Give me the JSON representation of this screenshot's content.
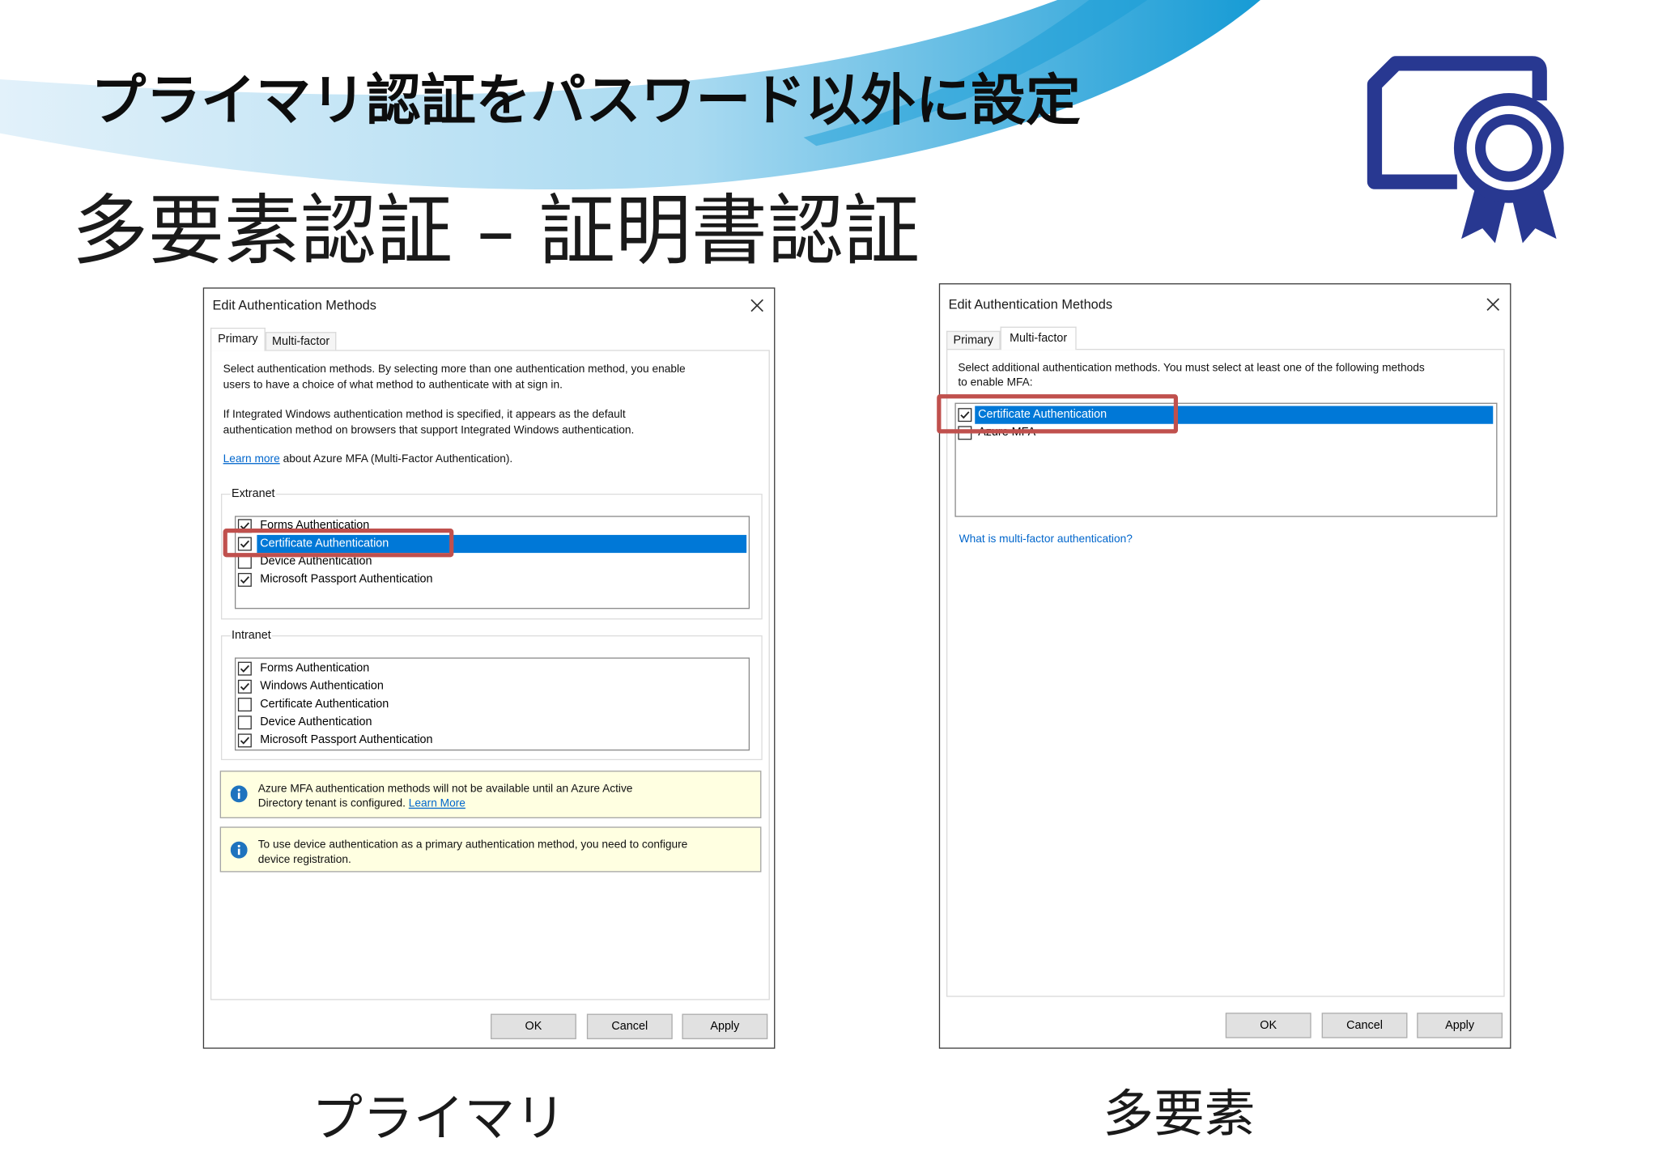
{
  "slide": {
    "title": "プライマリ認証をパスワード以外に設定",
    "subtitle": "多要素認証 – 証明書認証",
    "caption_primary": "プライマリ",
    "caption_multifactor": "多要素",
    "badge_icon": "certificate-icon"
  },
  "colors": {
    "highlight": "#0078d7",
    "annotation_red": "#c0504d",
    "link": "#0066cc",
    "info_bg": "#ffffe1",
    "info_icon": "#1e73be",
    "icon_navy": "#283891",
    "swoosh_light": "#e2f1fa",
    "swoosh_mid": "#a9daf1",
    "swoosh_dark": "#169bd5"
  },
  "primary_dialog": {
    "title": "Edit Authentication Methods",
    "close_icon": "close-icon",
    "tabs": [
      {
        "label": "Primary",
        "selected": true
      },
      {
        "label": "Multi-factor",
        "selected": false
      }
    ],
    "description_lines": [
      "Select authentication methods. By selecting more than one authentication method, you enable",
      "users to have a choice of what method to authenticate with at sign in."
    ],
    "default_note_lines": [
      "If Integrated Windows authentication method is specified, it appears as the default",
      "authentication method on browsers that support Integrated Windows authentication."
    ],
    "learn_more_link": "Learn more",
    "learn_more_text": "about Azure MFA (Multi-Factor Authentication).",
    "extranet": {
      "label": "Extranet",
      "items": [
        {
          "label": "Forms Authentication",
          "checked": true,
          "selected": false
        },
        {
          "label": "Certificate Authentication",
          "checked": true,
          "selected": true
        },
        {
          "label": "Device Authentication",
          "checked": false,
          "selected": false
        },
        {
          "label": "Microsoft Passport Authentication",
          "checked": true,
          "selected": false
        }
      ]
    },
    "intranet": {
      "label": "Intranet",
      "items": [
        {
          "label": "Forms Authentication",
          "checked": true,
          "selected": false
        },
        {
          "label": "Windows Authentication",
          "checked": true,
          "selected": false
        },
        {
          "label": "Certificate Authentication",
          "checked": false,
          "selected": false
        },
        {
          "label": "Device Authentication",
          "checked": false,
          "selected": false
        },
        {
          "label": "Microsoft Passport Authentication",
          "checked": true,
          "selected": false
        }
      ]
    },
    "notices": [
      {
        "icon": "info-icon",
        "lines": [
          "Azure MFA authentication methods will not be available until an Azure Active",
          "Directory tenant is configured."
        ],
        "link": "Learn More"
      },
      {
        "icon": "info-icon",
        "lines": [
          "To use device authentication as a primary authentication method, you need to configure",
          "device registration."
        ]
      }
    ],
    "buttons": {
      "ok": "OK",
      "cancel": "Cancel",
      "apply": "Apply"
    }
  },
  "multifactor_dialog": {
    "title": "Edit Authentication Methods",
    "close_icon": "close-icon",
    "tabs": [
      {
        "label": "Primary",
        "selected": false
      },
      {
        "label": "Multi-factor",
        "selected": true
      }
    ],
    "description_lines": [
      "Select additional authentication methods. You must select at least one of the following methods",
      "to enable MFA:"
    ],
    "methods": [
      {
        "label": "Certificate Authentication",
        "checked": true,
        "selected": true
      },
      {
        "label": "Azure MFA",
        "checked": false,
        "selected": false
      }
    ],
    "help_link": "What is multi-factor authentication?",
    "buttons": {
      "ok": "OK",
      "cancel": "Cancel",
      "apply": "Apply"
    }
  }
}
